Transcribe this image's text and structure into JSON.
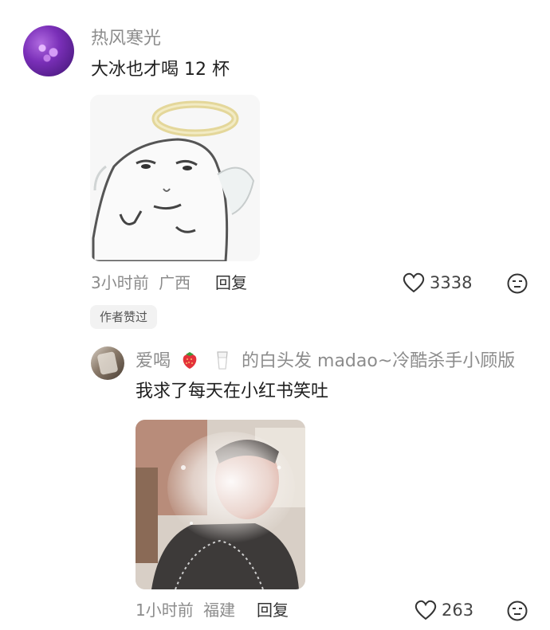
{
  "comments": [
    {
      "username": "热风寒光",
      "text": "大冰也才喝 12 杯",
      "time": "3小时前",
      "location": "广西",
      "reply_label": "回复",
      "likes": "3338",
      "badge": "作者赞过"
    },
    {
      "username_prefix": "爱喝",
      "username_suffix": "的白头发 madao~冷酷杀手小顾版",
      "username_emojis": [
        "strawberry-emoji",
        "milk-emoji"
      ],
      "text": "我求了每天在小红书笑吐",
      "time": "1小时前",
      "location": "福建",
      "reply_label": "回复",
      "likes": "263"
    }
  ],
  "icons": {
    "like": "heart-outline-icon",
    "react": "speechless-face-icon"
  }
}
